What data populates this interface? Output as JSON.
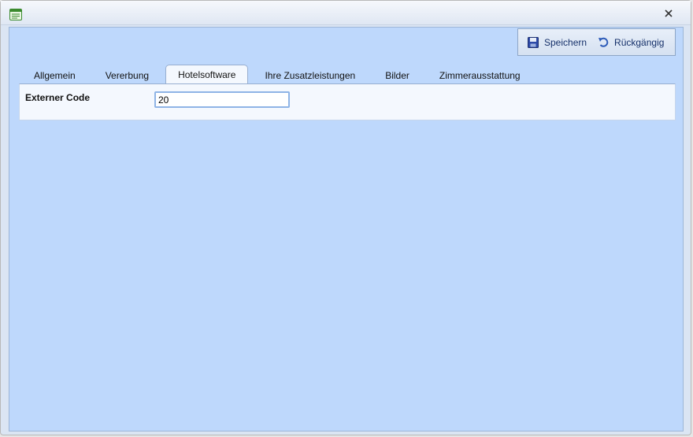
{
  "window": {
    "close_label": "x"
  },
  "toolbar": {
    "save_label": "Speichern",
    "undo_label": "Rückgängig"
  },
  "tabs": [
    {
      "label": "Allgemein"
    },
    {
      "label": "Vererbung"
    },
    {
      "label": "Hotelsoftware",
      "active": true
    },
    {
      "label": "Ihre Zusatzleistungen"
    },
    {
      "label": "Bilder"
    },
    {
      "label": "Zimmerausstattung"
    }
  ],
  "form": {
    "external_code_label": "Externer Code",
    "external_code_value": "20"
  },
  "icons": {
    "app": "form-window-icon",
    "save": "floppy-disk-icon",
    "undo": "undo-arrow-icon",
    "close": "close-icon"
  },
  "colors": {
    "body_bg": "#bed8fc",
    "panel_bg": "#f4f8fe",
    "accent": "#15306a"
  }
}
